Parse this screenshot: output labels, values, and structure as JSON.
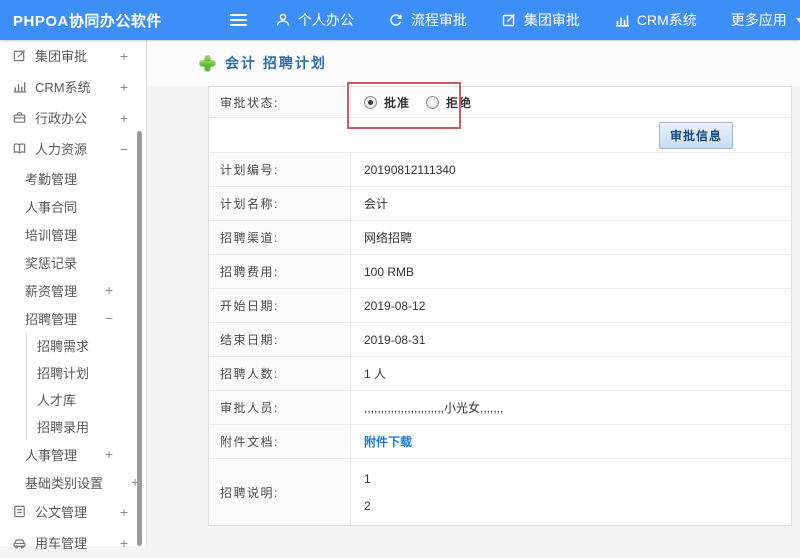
{
  "colors": {
    "topbar": "#3e8ef7",
    "page_title": "#2e6cad",
    "link": "#1d7ad9",
    "highlight_box": "#c75f5f",
    "button_face": "#c8dcf2"
  },
  "topbar": {
    "brand": "PHPOA协同办公软件",
    "menu_icon": "hamburger-icon",
    "nav": [
      {
        "label": "个人办公",
        "icon": "user-icon"
      },
      {
        "label": "流程审批",
        "icon": "process-icon"
      },
      {
        "label": "集团审批",
        "icon": "edit-icon"
      },
      {
        "label": "CRM系统",
        "icon": "chart-icon"
      },
      {
        "label": "更多应用",
        "icon": "caret-down-icon"
      }
    ]
  },
  "sidebar": {
    "items": [
      {
        "label": "集团审批",
        "icon": "edit-icon",
        "expand": "+",
        "level": 1
      },
      {
        "label": "CRM系统",
        "icon": "chart-icon",
        "expand": "+",
        "level": 1
      },
      {
        "label": "行政办公",
        "icon": "briefcase-icon",
        "expand": "+",
        "level": 1
      },
      {
        "label": "人力资源",
        "icon": "book-icon",
        "expand": "−",
        "level": 1
      },
      {
        "label": "考勤管理",
        "level": 2
      },
      {
        "label": "人事合同",
        "level": 2
      },
      {
        "label": "培训管理",
        "level": 2
      },
      {
        "label": "奖惩记录",
        "level": 2
      },
      {
        "label": "薪资管理",
        "expand": "+",
        "level": 2
      },
      {
        "label": "招聘管理",
        "expand": "−",
        "level": 2
      },
      {
        "label": "招聘需求",
        "level": 3
      },
      {
        "label": "招聘计划",
        "level": 3
      },
      {
        "label": "人才库",
        "level": 3
      },
      {
        "label": "招聘录用",
        "level": 3
      },
      {
        "label": "人事管理",
        "expand": "+",
        "level": 2
      },
      {
        "label": "基础类别设置",
        "expand": "+",
        "level": 2
      },
      {
        "label": "公文管理",
        "icon": "doc-icon",
        "expand": "+",
        "level": 1
      },
      {
        "label": "用车管理",
        "icon": "car-icon",
        "expand": "+",
        "level": 1
      }
    ]
  },
  "main": {
    "page_title": "会计 招聘计划",
    "form": {
      "status": {
        "label": "审批状态:",
        "options": [
          {
            "label": "批准",
            "selected": true
          },
          {
            "label": "拒绝",
            "selected": false
          }
        ]
      },
      "approve_button": "审批信息",
      "rows": [
        {
          "label": "计划编号:",
          "value": "20190812111340"
        },
        {
          "label": "计划名称:",
          "value": "会计"
        },
        {
          "label": "招聘渠道:",
          "value": "网络招聘"
        },
        {
          "label": "招聘费用:",
          "value": "100 RMB"
        },
        {
          "label": "开始日期:",
          "value": "2019-08-12"
        },
        {
          "label": "结束日期:",
          "value": "2019-08-31"
        },
        {
          "label": "招聘人数:",
          "value": "1 人"
        },
        {
          "label": "审批人员:",
          "value": ",,,,,,,,,,,,,,,,,,,,,,,,小光女,,,,,,,"
        },
        {
          "label": "附件文档:",
          "value": "附件下载"
        },
        {
          "label": "招聘说明:",
          "lines": [
            "1",
            "2"
          ]
        }
      ]
    }
  }
}
